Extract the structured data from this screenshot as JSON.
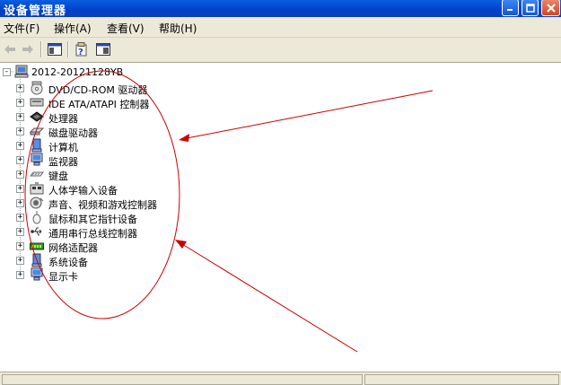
{
  "window": {
    "title": "设备管理器"
  },
  "menu": [
    {
      "label": "文件(F)"
    },
    {
      "label": "操作(A)"
    },
    {
      "label": "查看(V)"
    },
    {
      "label": "帮助(H)"
    }
  ],
  "tree": {
    "root": "2012-20121128YB",
    "items": [
      {
        "label": "DVD/CD-ROM 驱动器",
        "icon": "cdrom-icon"
      },
      {
        "label": "IDE ATA/ATAPI 控制器",
        "icon": "ide-controller-icon"
      },
      {
        "label": "处理器",
        "icon": "processor-icon"
      },
      {
        "label": "磁盘驱动器",
        "icon": "disk-drive-icon"
      },
      {
        "label": "计算机",
        "icon": "computer-icon"
      },
      {
        "label": "监视器",
        "icon": "monitor-icon"
      },
      {
        "label": "键盘",
        "icon": "keyboard-icon"
      },
      {
        "label": "人体学输入设备",
        "icon": "hid-icon"
      },
      {
        "label": "声音、视频和游戏控制器",
        "icon": "sound-icon"
      },
      {
        "label": "鼠标和其它指针设备",
        "icon": "mouse-icon"
      },
      {
        "label": "通用串行总线控制器",
        "icon": "usb-icon"
      },
      {
        "label": "网络适配器",
        "icon": "network-adapter-icon"
      },
      {
        "label": "系统设备",
        "icon": "system-device-icon"
      },
      {
        "label": "显示卡",
        "icon": "display-adapter-icon"
      }
    ]
  },
  "colors": {
    "titlebar": "#0a5fe0",
    "annotation": "#cc0000"
  }
}
